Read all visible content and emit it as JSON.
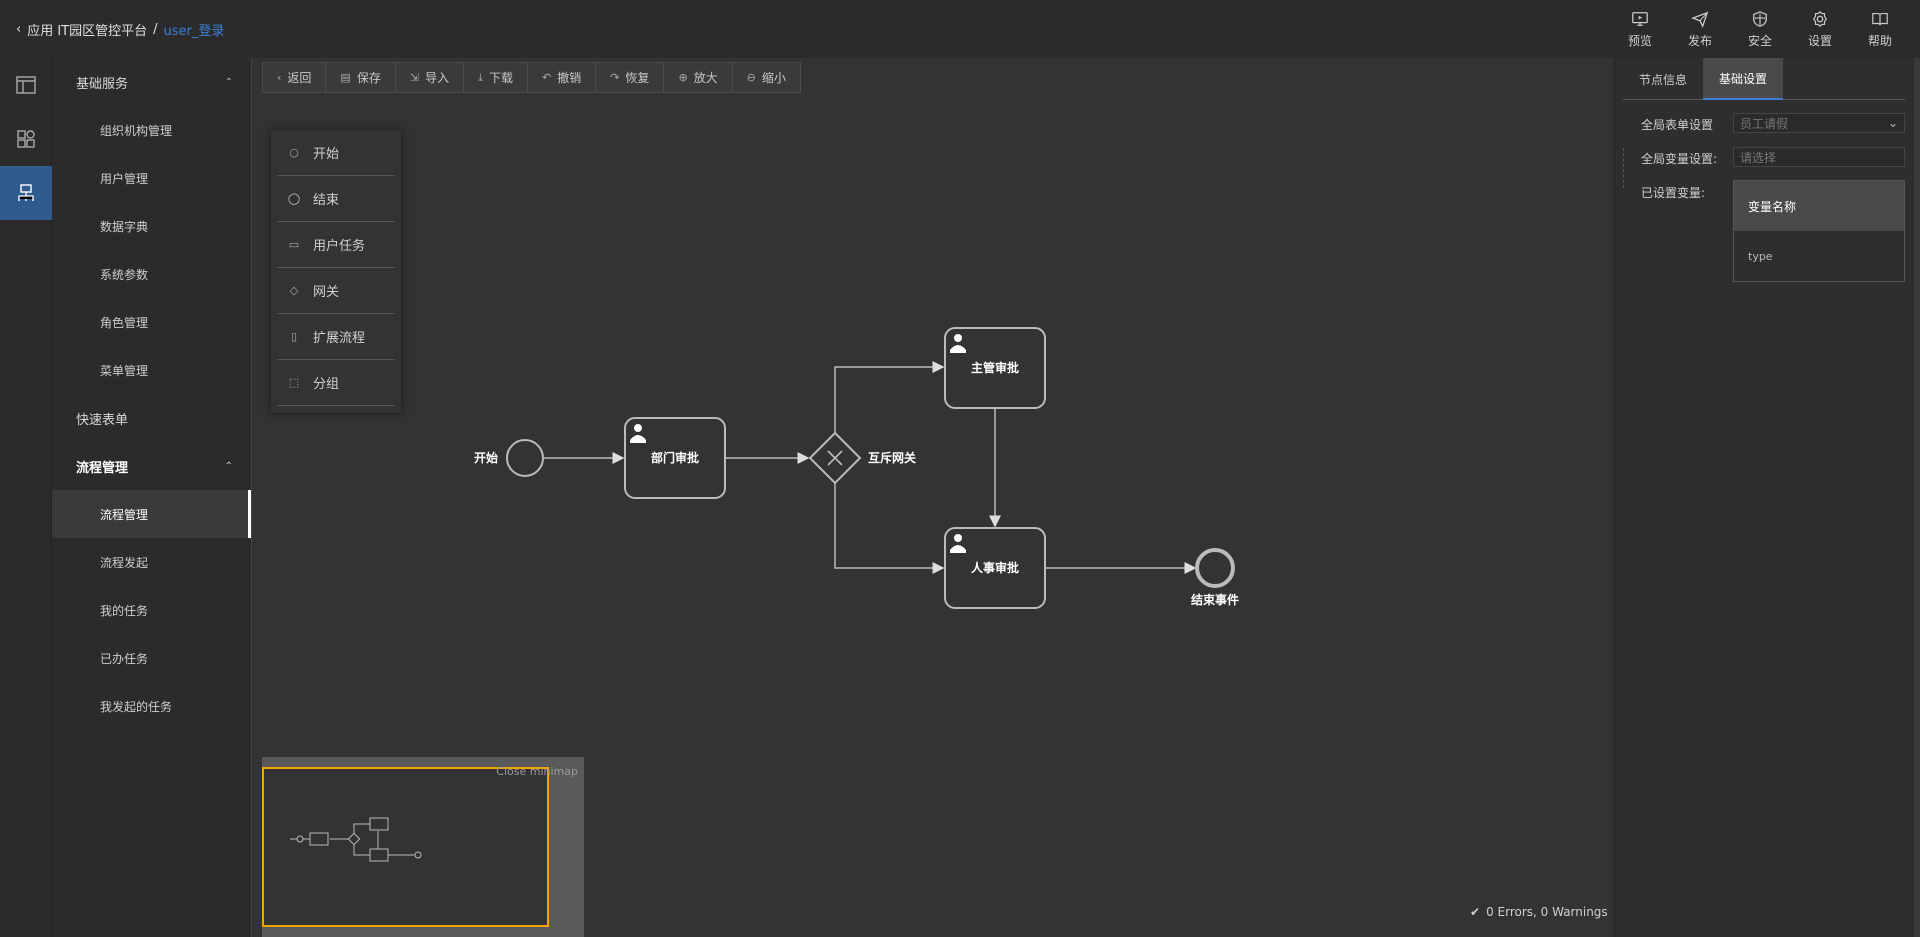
{
  "header": {
    "app_label": "应用 IT园区管控平台",
    "separator": "/",
    "current": "user_登录",
    "actions": [
      {
        "label": "预览",
        "icon": "monitor-icon"
      },
      {
        "label": "发布",
        "icon": "send-icon"
      },
      {
        "label": "安全",
        "icon": "shield-icon"
      },
      {
        "label": "设置",
        "icon": "gear-icon"
      },
      {
        "label": "帮助",
        "icon": "book-icon"
      }
    ]
  },
  "menu": {
    "group_basic": "基础服务",
    "basic_items": [
      "组织机构管理",
      "用户管理",
      "数据字典",
      "系统参数",
      "角色管理",
      "菜单管理"
    ],
    "quick_form": "快速表单",
    "group_flow": "流程管理",
    "flow_items": [
      "流程管理",
      "流程发起",
      "我的任务",
      "已办任务",
      "我发起的任务"
    ]
  },
  "toolbar": {
    "buttons": [
      "返回",
      "保存",
      "导入",
      "下载",
      "撤销",
      "恢复",
      "放大",
      "缩小"
    ]
  },
  "palette": {
    "items": [
      "开始",
      "结束",
      "用户任务",
      "网关",
      "扩展流程",
      "分组"
    ]
  },
  "diagram": {
    "start": "开始",
    "task_dept": "部门审批",
    "gateway": "互斥网关",
    "task_manager": "主管审批",
    "task_hr": "人事审批",
    "end": "结束事件"
  },
  "minimap": {
    "close": "Close minimap"
  },
  "status": {
    "text": "0 Errors, 0 Warnings"
  },
  "panel": {
    "tab_node": "节点信息",
    "tab_basic": "基础设置",
    "global_form_label": "全局表单设置",
    "global_form_value": "员工请假",
    "global_var_label": "全局变量设置:",
    "global_var_placeholder": "请选择",
    "set_vars_label": "已设置变量:",
    "var_header": "变量名称",
    "var_row": "type"
  },
  "colors": {
    "accent": "#3d7fd6",
    "minimap_frame": "#f0a500",
    "rail_active": "#2f5b8f"
  }
}
